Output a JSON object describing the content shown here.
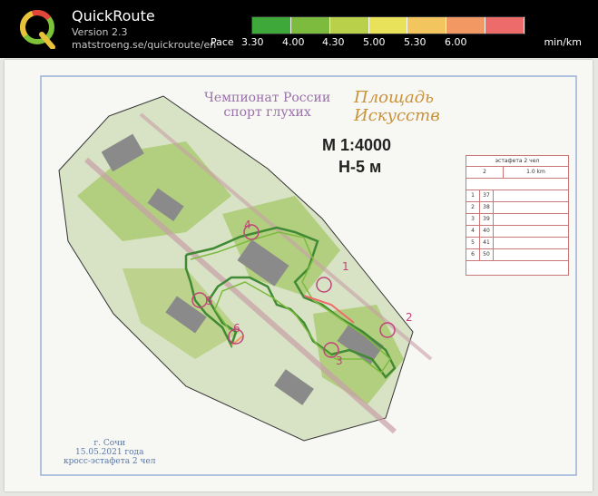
{
  "app": {
    "title": "QuickRoute",
    "version": "Version 2.3",
    "url": "matstroeng.se/quickroute/en"
  },
  "pace_scale": {
    "label": "Pace",
    "ticks": [
      "3.30",
      "4.00",
      "4.30",
      "5.00",
      "5.30",
      "6.00"
    ],
    "unit": "min/km",
    "colors": [
      "#3fa83a",
      "#7dbb3e",
      "#b8d04a",
      "#e8e25a",
      "#f3c55e",
      "#f29862",
      "#ee6b6b"
    ]
  },
  "map": {
    "title_line1": "Чемпионат России",
    "title_line2": "спорт глухих",
    "place_line1": "Площадь",
    "place_line2": "Искусств",
    "scale": "М 1:4000",
    "contour": "Н-5 м",
    "legend_title": "эстафета 2 чел",
    "legend_header": [
      "2",
      "1.0 km"
    ],
    "legend_rows": [
      [
        "1",
        "37"
      ],
      [
        "2",
        "38"
      ],
      [
        "3",
        "39"
      ],
      [
        "4",
        "40"
      ],
      [
        "5",
        "41"
      ],
      [
        "6",
        "50"
      ]
    ],
    "control_labels": [
      "1",
      "2",
      "3",
      "4",
      "5",
      "6"
    ],
    "credits_line1": "г. Сочи",
    "credits_line2": "15.05.2021 года",
    "credits_line3": "кросс-эстафета 2 чел"
  }
}
